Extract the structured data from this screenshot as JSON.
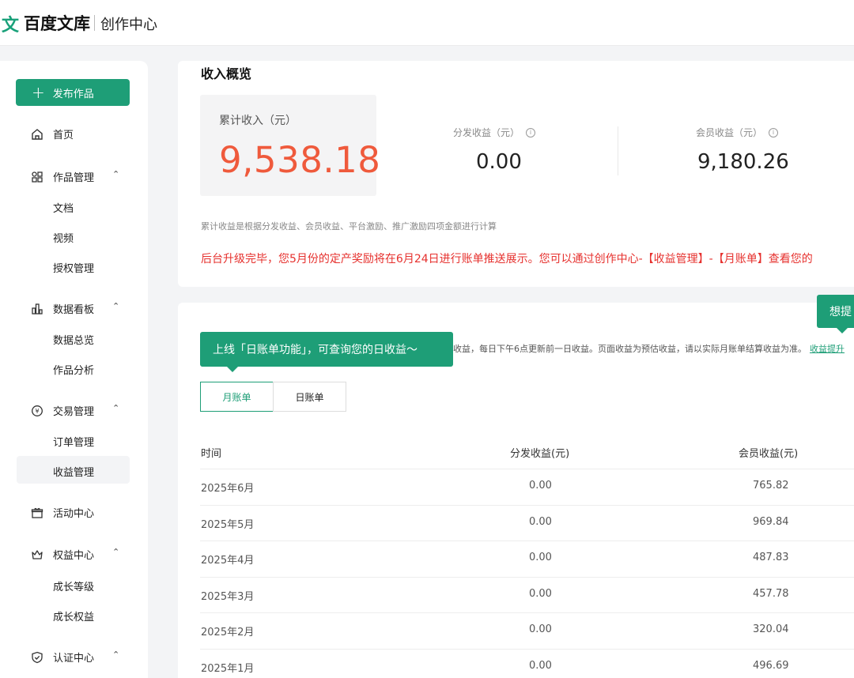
{
  "header": {
    "logo_mark": "文",
    "logo_text": "百度文库",
    "logo_sub": "创作中心"
  },
  "sidebar": {
    "publish_label": "发布作品",
    "home": "首页",
    "works_mgmt": "作品管理",
    "works_sub": [
      "文档",
      "视频",
      "授权管理"
    ],
    "dashboard": "数据看板",
    "dashboard_sub": [
      "数据总览",
      "作品分析"
    ],
    "trade": "交易管理",
    "trade_sub": [
      "订单管理",
      "收益管理"
    ],
    "events": "活动中心",
    "rights": "权益中心",
    "rights_sub": [
      "成长等级",
      "成长权益"
    ],
    "cert": "认证中心"
  },
  "overview": {
    "title": "收入概览",
    "total_label": "累计收入（元）",
    "total_value": "9,538.18",
    "dist_label": "分发收益（元）",
    "dist_value": "0.00",
    "member_label": "会员收益（元）",
    "member_value": "9,180.26",
    "note": "累计收益是根据分发收益、会员收益、平台激励、推广激励四项金额进行计算",
    "alert": "后台升级完毕，您5月份的定产奖励将在6月24日进行账单推送展示。您可以通过创作中心-【收益管理】-【月账单】查看您的"
  },
  "bills": {
    "tooltip": "上线「日账单功能」，可查询您的日收益～",
    "tooltip2": "想提",
    "desc": "收益，每日下午6点更新前一日收益。页面收益为预估收益，请以实际月账单结算收益为准。",
    "desc_link": "收益提升",
    "tab_month": "月账单",
    "tab_day": "日账单",
    "columns": [
      "时间",
      "分发收益(元)",
      "会员收益(元)"
    ],
    "rows": [
      {
        "time": "2025年6月",
        "dist": "0.00",
        "member": "765.82"
      },
      {
        "time": "2025年5月",
        "dist": "0.00",
        "member": "969.84"
      },
      {
        "time": "2025年4月",
        "dist": "0.00",
        "member": "487.83"
      },
      {
        "time": "2025年3月",
        "dist": "0.00",
        "member": "457.78"
      },
      {
        "time": "2025年2月",
        "dist": "0.00",
        "member": "320.04"
      },
      {
        "time": "2025年1月",
        "dist": "0.00",
        "member": "496.69"
      }
    ]
  },
  "colors": {
    "brand": "#1e9e77",
    "total_value": "#ef5a3c",
    "alert": "#e6312e"
  }
}
